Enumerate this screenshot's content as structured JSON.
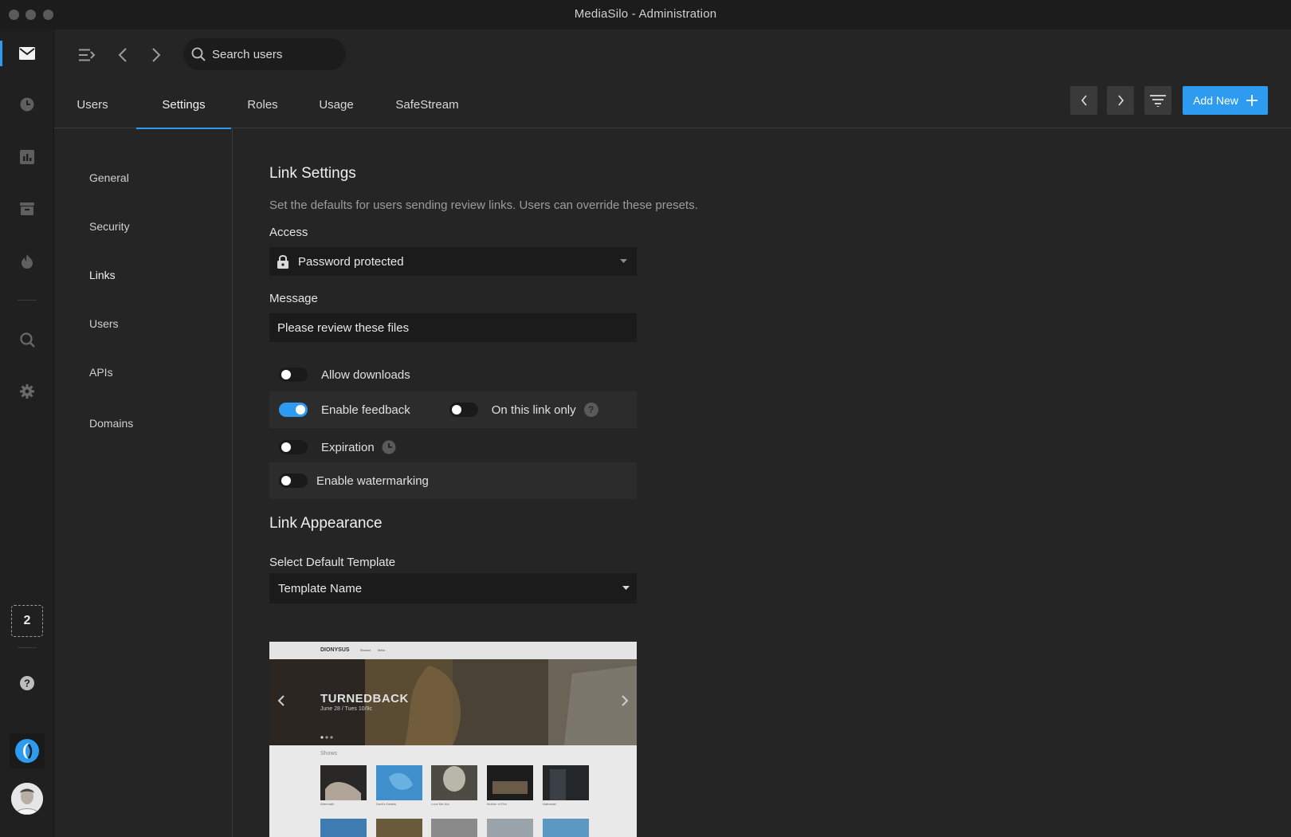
{
  "window": {
    "title": "MediaSilo  -  Administration"
  },
  "search": {
    "placeholder": "Search users"
  },
  "tabs": [
    {
      "label": "Users"
    },
    {
      "label": "Settings",
      "active": true
    },
    {
      "label": "Roles"
    },
    {
      "label": "Usage"
    },
    {
      "label": "SafeStream"
    }
  ],
  "toolbar": {
    "add_new_label": "Add New"
  },
  "rail": {
    "counter": "2"
  },
  "subnav": [
    {
      "label": "General"
    },
    {
      "label": "Security"
    },
    {
      "label": "Links",
      "active": true
    },
    {
      "label": "Users"
    },
    {
      "label": "APIs"
    },
    {
      "label": "Domains"
    }
  ],
  "link_settings": {
    "title": "Link Settings",
    "description": "Set the defaults for users sending review links. Users can override these presets.",
    "access_label": "Access",
    "access_value": "Password protected",
    "message_label": "Message",
    "message_value": "Please review these files",
    "toggles": {
      "allow_downloads": {
        "label": "Allow downloads",
        "on": false
      },
      "enable_feedback": {
        "label": "Enable feedback",
        "on": true
      },
      "on_this_link_only": {
        "label": "On this link only",
        "on": false
      },
      "expiration": {
        "label": "Expiration",
        "on": false
      },
      "enable_watermarking": {
        "label": "Enable watermarking",
        "on": false
      }
    }
  },
  "link_appearance": {
    "title": "Link Appearance",
    "template_label": "Select Default Template",
    "template_value": "Template Name",
    "preview": {
      "brand": "DIONYSUS",
      "nav": [
        "Browse",
        "Meta"
      ],
      "hero_title": "TURNEDBACK",
      "hero_subtitle": "June 28 / Tues 10/9c",
      "section": "Shows",
      "shows": [
        "Aftermath",
        "Devil's Details",
        "Love Me Not",
        "Mother of Fire",
        "Nathaniel"
      ]
    }
  },
  "colors": {
    "accent": "#2d9cf0",
    "background": "#252525",
    "rail": "#202020"
  }
}
